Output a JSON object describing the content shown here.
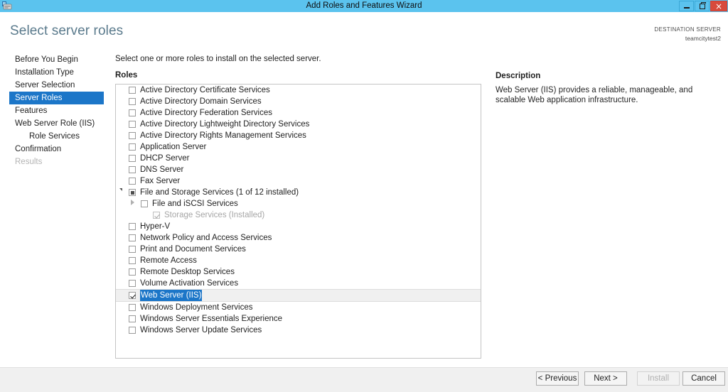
{
  "window": {
    "title": "Add Roles and Features Wizard",
    "icon": "server-icon",
    "minimize_label": "",
    "maximize_label": "",
    "close_label": "×",
    "titlebar_color": "#5bc3ee",
    "close_color": "#d84a3c"
  },
  "header": {
    "page_title": "Select server roles",
    "destination_label": "DESTINATION SERVER",
    "destination_value": "teamcitytest2"
  },
  "sidebar": {
    "items": [
      {
        "label": "Before You Begin",
        "selected": false,
        "disabled": false,
        "sub": false
      },
      {
        "label": "Installation Type",
        "selected": false,
        "disabled": false,
        "sub": false
      },
      {
        "label": "Server Selection",
        "selected": false,
        "disabled": false,
        "sub": false
      },
      {
        "label": "Server Roles",
        "selected": true,
        "disabled": false,
        "sub": false
      },
      {
        "label": "Features",
        "selected": false,
        "disabled": false,
        "sub": false
      },
      {
        "label": "Web Server Role (IIS)",
        "selected": false,
        "disabled": false,
        "sub": false
      },
      {
        "label": "Role Services",
        "selected": false,
        "disabled": false,
        "sub": true
      },
      {
        "label": "Confirmation",
        "selected": false,
        "disabled": false,
        "sub": false
      },
      {
        "label": "Results",
        "selected": false,
        "disabled": true,
        "sub": false
      }
    ],
    "selected_color": "#1c76c8"
  },
  "main": {
    "instruction": "Select one or more roles to install on the selected server.",
    "roles_label": "Roles",
    "roles": [
      {
        "label": "Active Directory Certificate Services",
        "state": "unchecked",
        "indent": 0,
        "expander": "none",
        "row_selected": false
      },
      {
        "label": "Active Directory Domain Services",
        "state": "unchecked",
        "indent": 0,
        "expander": "none",
        "row_selected": false
      },
      {
        "label": "Active Directory Federation Services",
        "state": "unchecked",
        "indent": 0,
        "expander": "none",
        "row_selected": false
      },
      {
        "label": "Active Directory Lightweight Directory Services",
        "state": "unchecked",
        "indent": 0,
        "expander": "none",
        "row_selected": false
      },
      {
        "label": "Active Directory Rights Management Services",
        "state": "unchecked",
        "indent": 0,
        "expander": "none",
        "row_selected": false
      },
      {
        "label": "Application Server",
        "state": "unchecked",
        "indent": 0,
        "expander": "none",
        "row_selected": false
      },
      {
        "label": "DHCP Server",
        "state": "unchecked",
        "indent": 0,
        "expander": "none",
        "row_selected": false
      },
      {
        "label": "DNS Server",
        "state": "unchecked",
        "indent": 0,
        "expander": "none",
        "row_selected": false
      },
      {
        "label": "Fax Server",
        "state": "unchecked",
        "indent": 0,
        "expander": "none",
        "row_selected": false
      },
      {
        "label": "File and Storage Services (1 of 12 installed)",
        "state": "partial",
        "indent": 0,
        "expander": "open",
        "row_selected": false
      },
      {
        "label": "File and iSCSI Services",
        "state": "unchecked",
        "indent": 1,
        "expander": "closed",
        "row_selected": false
      },
      {
        "label": "Storage Services (Installed)",
        "state": "installed",
        "indent": 2,
        "expander": "none",
        "row_selected": false
      },
      {
        "label": "Hyper-V",
        "state": "unchecked",
        "indent": 0,
        "expander": "none",
        "row_selected": false
      },
      {
        "label": "Network Policy and Access Services",
        "state": "unchecked",
        "indent": 0,
        "expander": "none",
        "row_selected": false
      },
      {
        "label": "Print and Document Services",
        "state": "unchecked",
        "indent": 0,
        "expander": "none",
        "row_selected": false
      },
      {
        "label": "Remote Access",
        "state": "unchecked",
        "indent": 0,
        "expander": "none",
        "row_selected": false
      },
      {
        "label": "Remote Desktop Services",
        "state": "unchecked",
        "indent": 0,
        "expander": "none",
        "row_selected": false
      },
      {
        "label": "Volume Activation Services",
        "state": "unchecked",
        "indent": 0,
        "expander": "none",
        "row_selected": false
      },
      {
        "label": "Web Server (IIS)",
        "state": "checked",
        "indent": 0,
        "expander": "none",
        "row_selected": true
      },
      {
        "label": "Windows Deployment Services",
        "state": "unchecked",
        "indent": 0,
        "expander": "none",
        "row_selected": false
      },
      {
        "label": "Windows Server Essentials Experience",
        "state": "unchecked",
        "indent": 0,
        "expander": "none",
        "row_selected": false
      },
      {
        "label": "Windows Server Update Services",
        "state": "unchecked",
        "indent": 0,
        "expander": "none",
        "row_selected": false
      }
    ]
  },
  "description": {
    "title": "Description",
    "text": "Web Server (IIS) provides a reliable, manageable, and scalable Web application infrastructure."
  },
  "footer": {
    "previous_label": "< Previous",
    "next_label": "Next >",
    "install_label": "Install",
    "cancel_label": "Cancel",
    "install_disabled": true
  }
}
